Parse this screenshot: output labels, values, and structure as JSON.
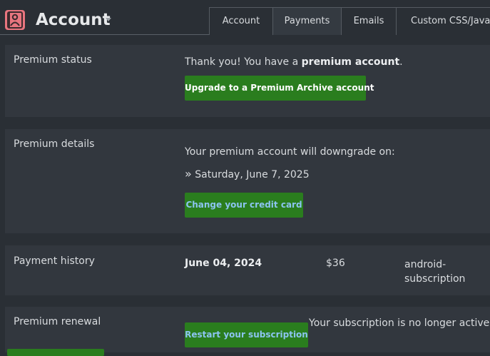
{
  "header": {
    "title": "Account",
    "icon": "account-icon"
  },
  "tabs": [
    {
      "label": "Account",
      "active": false
    },
    {
      "label": "Payments",
      "active": true
    },
    {
      "label": "Emails",
      "active": false
    },
    {
      "label": "Custom CSS/JavaScript",
      "active": false
    }
  ],
  "premium_status": {
    "label": "Premium status",
    "message_prefix": "Thank you! You have a ",
    "message_bold": "premium account",
    "message_suffix": ".",
    "button": "Upgrade to a Premium Archive account"
  },
  "premium_details": {
    "label": "Premium details",
    "message": "Your premium account will downgrade on:",
    "bullet": "»",
    "date": "Saturday, June 7, 2025",
    "button": "Change your credit card"
  },
  "payment_history": {
    "label": "Payment history",
    "rows": [
      {
        "date": "June 04, 2024",
        "amount": "$36",
        "method": "android-subscription"
      }
    ]
  },
  "premium_renewal": {
    "label": "Premium renewal",
    "button": "Restart your subscription",
    "message": "Your subscription is no longer active."
  },
  "colors": {
    "background": "#2a2f35",
    "section": "#32373e",
    "button": "#2a7d1e",
    "icon": "#e8757f"
  }
}
